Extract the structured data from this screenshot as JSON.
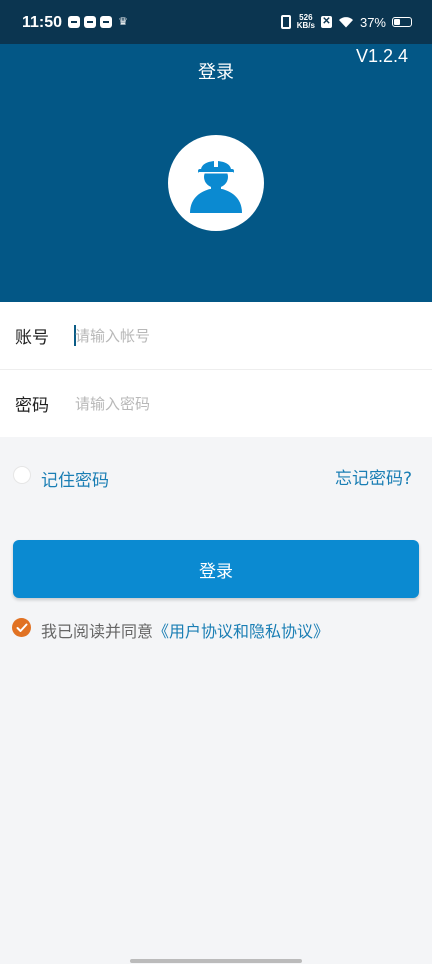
{
  "status_bar": {
    "time": "11:50",
    "net_speed_value": "526",
    "net_speed_unit": "KB/s",
    "battery": "37%"
  },
  "header": {
    "title": "登录",
    "version": "V1.2.4",
    "avatar_icon": "worker-hardhat-icon"
  },
  "form": {
    "account_label": "账号",
    "account_placeholder": "请输入帐号",
    "password_label": "密码",
    "password_placeholder": "请输入密码"
  },
  "remember": {
    "label": "记住密码",
    "checked": false
  },
  "forgot_password": "忘记密码?",
  "login_button": "登录",
  "agreement": {
    "prefix": "我已阅读并同意",
    "link": "《用户协议和隐私协议》",
    "checked": true
  },
  "colors": {
    "header_bg": "#035786",
    "accent": "#0b8ad1",
    "link": "#1a7eb4",
    "check": "#e17223"
  }
}
